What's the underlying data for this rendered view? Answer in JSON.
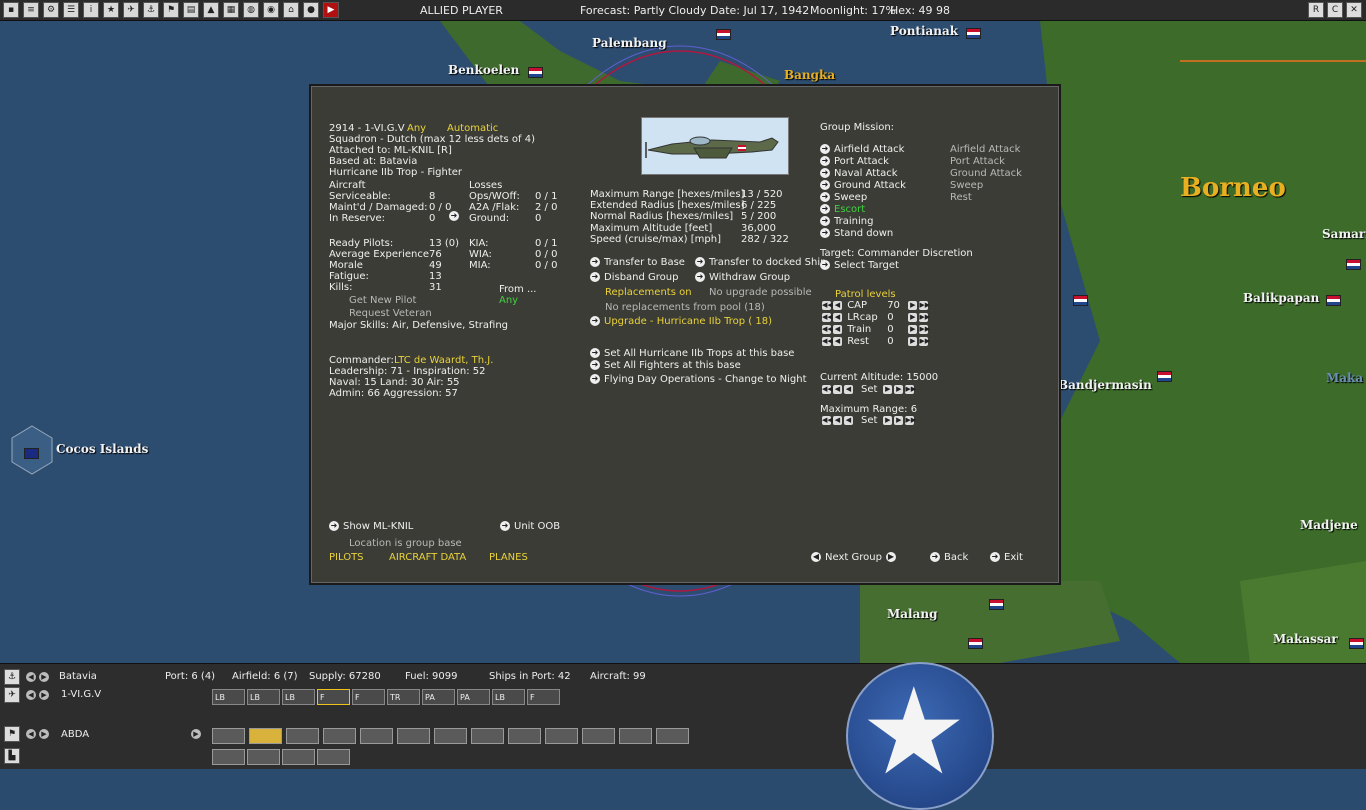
{
  "topbar": {
    "title": "ALLIED PLAYER",
    "forecast": "Forecast: Partly Cloudy",
    "date": "Date: Jul 17, 1942",
    "moonlight": "Moonlight: 17%",
    "hex": "Hex: 49 98",
    "icons": [
      "save-icon",
      "notes-icon",
      "settings-icon",
      "list-icon",
      "info-icon",
      "medal-icon",
      "plane-icon",
      "ship-icon",
      "flag-icon",
      "map-icon",
      "land-icon",
      "base-icon",
      "globe-icon",
      "ob-icon",
      "intel-icon",
      "report-icon",
      "end-turn-icon"
    ],
    "window_buttons": [
      "R",
      "C",
      "X"
    ]
  },
  "map": {
    "labels": {
      "palembang": "Palembang",
      "pontianak": "Pontianak",
      "benkoelen": "Benkoelen",
      "bangka": "Bangka",
      "borneo": "Borneo",
      "samari": "Samari",
      "balikpapan": "Balikpapan",
      "bandjermasin": "Bandjermasin",
      "maka": "Maka",
      "cocos": "Cocos Islands",
      "madjene": "Madjene",
      "malang": "Malang",
      "makassar": "Makassar"
    }
  },
  "dialog": {
    "header": {
      "unit": "2914 - 1-VI.G.V",
      "any": "Any",
      "automatic": "Automatic",
      "squadron": "Squadron - Dutch (max 12 less dets of 4)",
      "attached": "Attached to:  ML-KNIL [R]",
      "based": "Based at: Batavia",
      "aircraft_type": "Hurricane IIb Trop - Fighter"
    },
    "aircraft": {
      "heading": "Aircraft",
      "serviceable_label": "Serviceable:",
      "serviceable": "8",
      "maint_label": "Maint'd / Damaged:",
      "maint": "0 / 0",
      "reserve_label": "In Reserve:",
      "reserve": "0"
    },
    "losses": {
      "heading": "Losses",
      "ops_label": "Ops/WOff:",
      "ops": "0 / 1",
      "a2a_label": "A2A /Flak:",
      "a2a": "2 / 0",
      "ground_label": "Ground:",
      "ground": "0"
    },
    "pilots": {
      "ready_label": "Ready Pilots:",
      "ready": "13 (0)",
      "exp_label": "Average Experience",
      "exp": "76",
      "morale_label": "Morale",
      "morale": "49",
      "fatigue_label": "Fatigue:",
      "fatigue": "13",
      "kills_label": "Kills:",
      "kills": "31",
      "kia_label": "KIA:",
      "kia": "0 / 1",
      "wia_label": "WIA:",
      "wia": "0 / 0",
      "mia_label": "MIA:",
      "mia": "0 / 0",
      "from_label": "From ...",
      "from_value": "Any",
      "get_pilot": "Get New Pilot",
      "request_veteran": "Request Veteran",
      "skills": "Major Skills: Air, Defensive, Strafing"
    },
    "commander": {
      "label": "Commander:",
      "name": "LTC de Waardt, Th.J.",
      "leadership": "Leadership: 71 - Inspiration: 52",
      "naval": " Naval:  15  Land:  30  Air:  55",
      "admin": " Admin:  66  Aggression:  57"
    },
    "specs": {
      "max_range_label": "Maximum Range [hexes/miles]",
      "max_range": "13 / 520",
      "ext_radius_label": "Extended Radius [hexes/miles]",
      "ext_radius": "6 / 225",
      "norm_radius_label": "Normal Radius [hexes/miles]",
      "norm_radius": "5 / 200",
      "max_alt_label": "Maximum Altitude [feet]",
      "max_alt": "36,000",
      "speed_label": "Speed (cruise/max) [mph]",
      "speed": "282 / 322"
    },
    "actions": {
      "transfer_base": "Transfer to Base",
      "transfer_ship": "Transfer to docked Ship",
      "disband": "Disband Group",
      "withdraw": "Withdraw Group",
      "replacements_on": "Replacements on",
      "no_upgrade": "No upgrade possible",
      "no_replacements": "No replacements from pool (18)",
      "upgrade": "Upgrade - Hurricane IIb Trop  ( 18)",
      "set_all_type": "Set All Hurricane IIb Trops at this base",
      "set_all_fighters": "Set All Fighters at this base",
      "flying": "Flying Day Operations - Change to Night"
    },
    "mission": {
      "heading": "Group Mission:",
      "items": [
        "Airfield Attack",
        "Port Attack",
        "Naval Attack",
        "Ground Attack",
        "Sweep",
        "Escort",
        "Training",
        "Stand down"
      ],
      "secondary": [
        "Airfield Attack",
        "Port Attack",
        "Ground Attack",
        "Sweep",
        "Rest"
      ],
      "target": "Target: Commander Discretion",
      "select_target": "Select Target"
    },
    "patrol": {
      "heading": "Patrol levels",
      "rows": [
        {
          "label": "CAP",
          "value": "70"
        },
        {
          "label": "LRcap",
          "value": "0"
        },
        {
          "label": "Train",
          "value": "0"
        },
        {
          "label": "Rest",
          "value": "0"
        }
      ]
    },
    "altitude": {
      "current": "Current Altitude: 15000",
      "set": "Set",
      "max_range": "Maximum Range: 6"
    },
    "footer": {
      "show_hq": "Show ML-KNIL",
      "unit_oob": "Unit OOB",
      "location": "Location is group base",
      "pilots_tab": "PILOTS",
      "aircraft_tab": "AIRCRAFT DATA",
      "planes_tab": "PLANES",
      "next_group": "Next Group",
      "back": "Back",
      "exit": "Exit"
    }
  },
  "bottom": {
    "base_name": "Batavia",
    "port": "Port: 6 (4)",
    "airfield": "Airfield: 6 (7)",
    "supply": "Supply: 67280",
    "fuel": "Fuel: 9099",
    "ships": "Ships in Port: 42",
    "aircraft": "Aircraft: 99",
    "unit_name": "1-VI.G.V",
    "hq_name": "ABDA",
    "aircraft_buttons": [
      "LB",
      "LB",
      "LB",
      "F",
      "F",
      "TR",
      "PA",
      "PA",
      "LB",
      "F"
    ]
  },
  "colors": {
    "yellow": "#e8d23a",
    "green": "#3fd23f",
    "panel": "#3c3c36",
    "map_sea": "#2c4c70"
  }
}
